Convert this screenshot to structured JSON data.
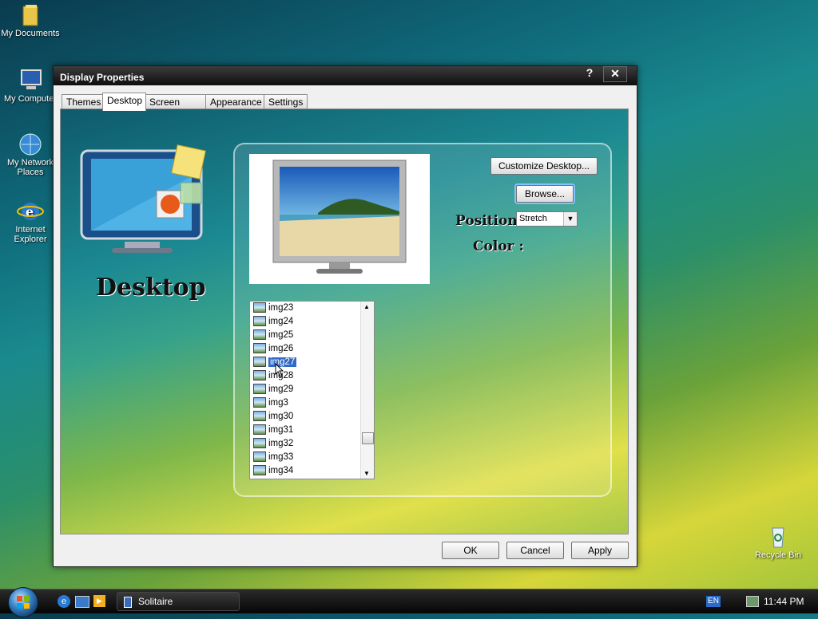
{
  "desktop": {
    "icons": [
      {
        "label": "My Documents"
      },
      {
        "label": "My Computer"
      },
      {
        "label": "My Network Places"
      },
      {
        "label": "Internet Explorer"
      },
      {
        "label": "Recycle Bin"
      }
    ]
  },
  "window": {
    "title": "Display Properties",
    "help_glyph": "?",
    "close_glyph": "✕",
    "tabs": [
      "Themes",
      "Desktop",
      "Screen Saver",
      "Appearance",
      "Settings"
    ],
    "active_tab": "Desktop",
    "banner_text": "Desktop",
    "customize_label": "Customize Desktop...",
    "browse_label": "Browse...",
    "position_label": "Position :",
    "position_value": "Stretch",
    "color_label": "Color :",
    "backgrounds": [
      "img23",
      "img24",
      "img25",
      "img26",
      "img27",
      "img28",
      "img29",
      "img3",
      "img30",
      "img31",
      "img32",
      "img33",
      "img34"
    ],
    "selected_background": "img27",
    "ok_label": "OK",
    "cancel_label": "Cancel",
    "apply_label": "Apply"
  },
  "taskbar": {
    "task_label": "Solitaire",
    "language": "EN",
    "clock": "11:44 PM"
  },
  "colors": {
    "selection": "#3169c6",
    "titlebar": "#0e0e0e"
  }
}
